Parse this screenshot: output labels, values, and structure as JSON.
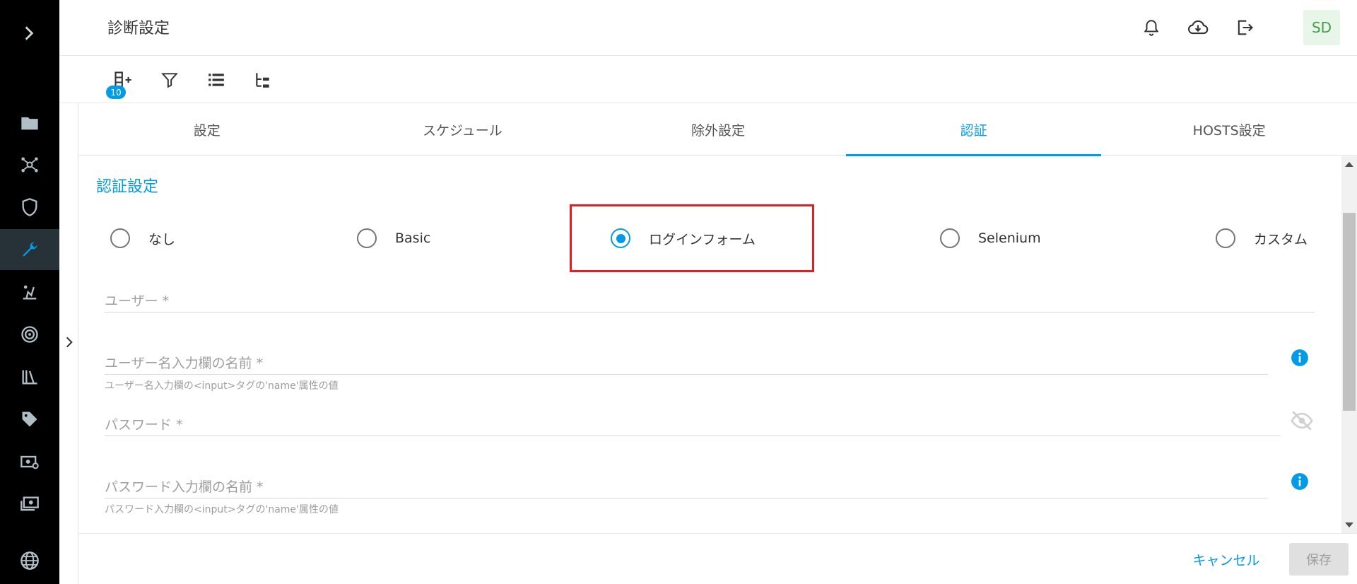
{
  "header": {
    "title": "診断設定",
    "avatar_initials": "SD"
  },
  "toolbar": {
    "badge_count": "10"
  },
  "tabs": [
    {
      "label": "設定",
      "active": false
    },
    {
      "label": "スケジュール",
      "active": false
    },
    {
      "label": "除外設定",
      "active": false
    },
    {
      "label": "認証",
      "active": true
    },
    {
      "label": "HOSTS設定",
      "active": false
    }
  ],
  "auth": {
    "section_title": "認証設定",
    "options": [
      {
        "label": "なし",
        "checked": false
      },
      {
        "label": "Basic",
        "checked": false
      },
      {
        "label": "ログインフォーム",
        "checked": true
      },
      {
        "label": "Selenium",
        "checked": false
      },
      {
        "label": "カスタム",
        "checked": false
      }
    ],
    "fields": {
      "user": {
        "label": "ユーザー *"
      },
      "user_field_name": {
        "label": "ユーザー名入力欄の名前 *",
        "help": "ユーザー名入力欄の<input>タグの'name'属性の値"
      },
      "password": {
        "label": "パスワード *"
      },
      "password_field_name": {
        "label": "パスワード入力欄の名前 *",
        "help": "パスワード入力欄の<input>タグの'name'属性の値"
      }
    }
  },
  "footer": {
    "cancel_label": "キャンセル",
    "save_label": "保存"
  },
  "colors": {
    "accent": "#039be5",
    "highlight": "#e02020",
    "sidebar_bg": "#000000",
    "avatar_bg": "#e8f5e9",
    "avatar_text": "#43a047"
  },
  "icons": {
    "sidebar": [
      "chevron-right-icon",
      "folder-icon",
      "network-icon",
      "shield-icon",
      "wrench-icon",
      "scan-icon",
      "radar-icon",
      "library-icon",
      "tag-icon",
      "billing-icon",
      "payment-icon",
      "globe-icon"
    ],
    "header": [
      "bell-icon",
      "cloud-download-icon",
      "logout-icon"
    ],
    "toolbar": [
      "add-row-icon",
      "filter-icon",
      "list-icon",
      "tree-icon"
    ]
  }
}
